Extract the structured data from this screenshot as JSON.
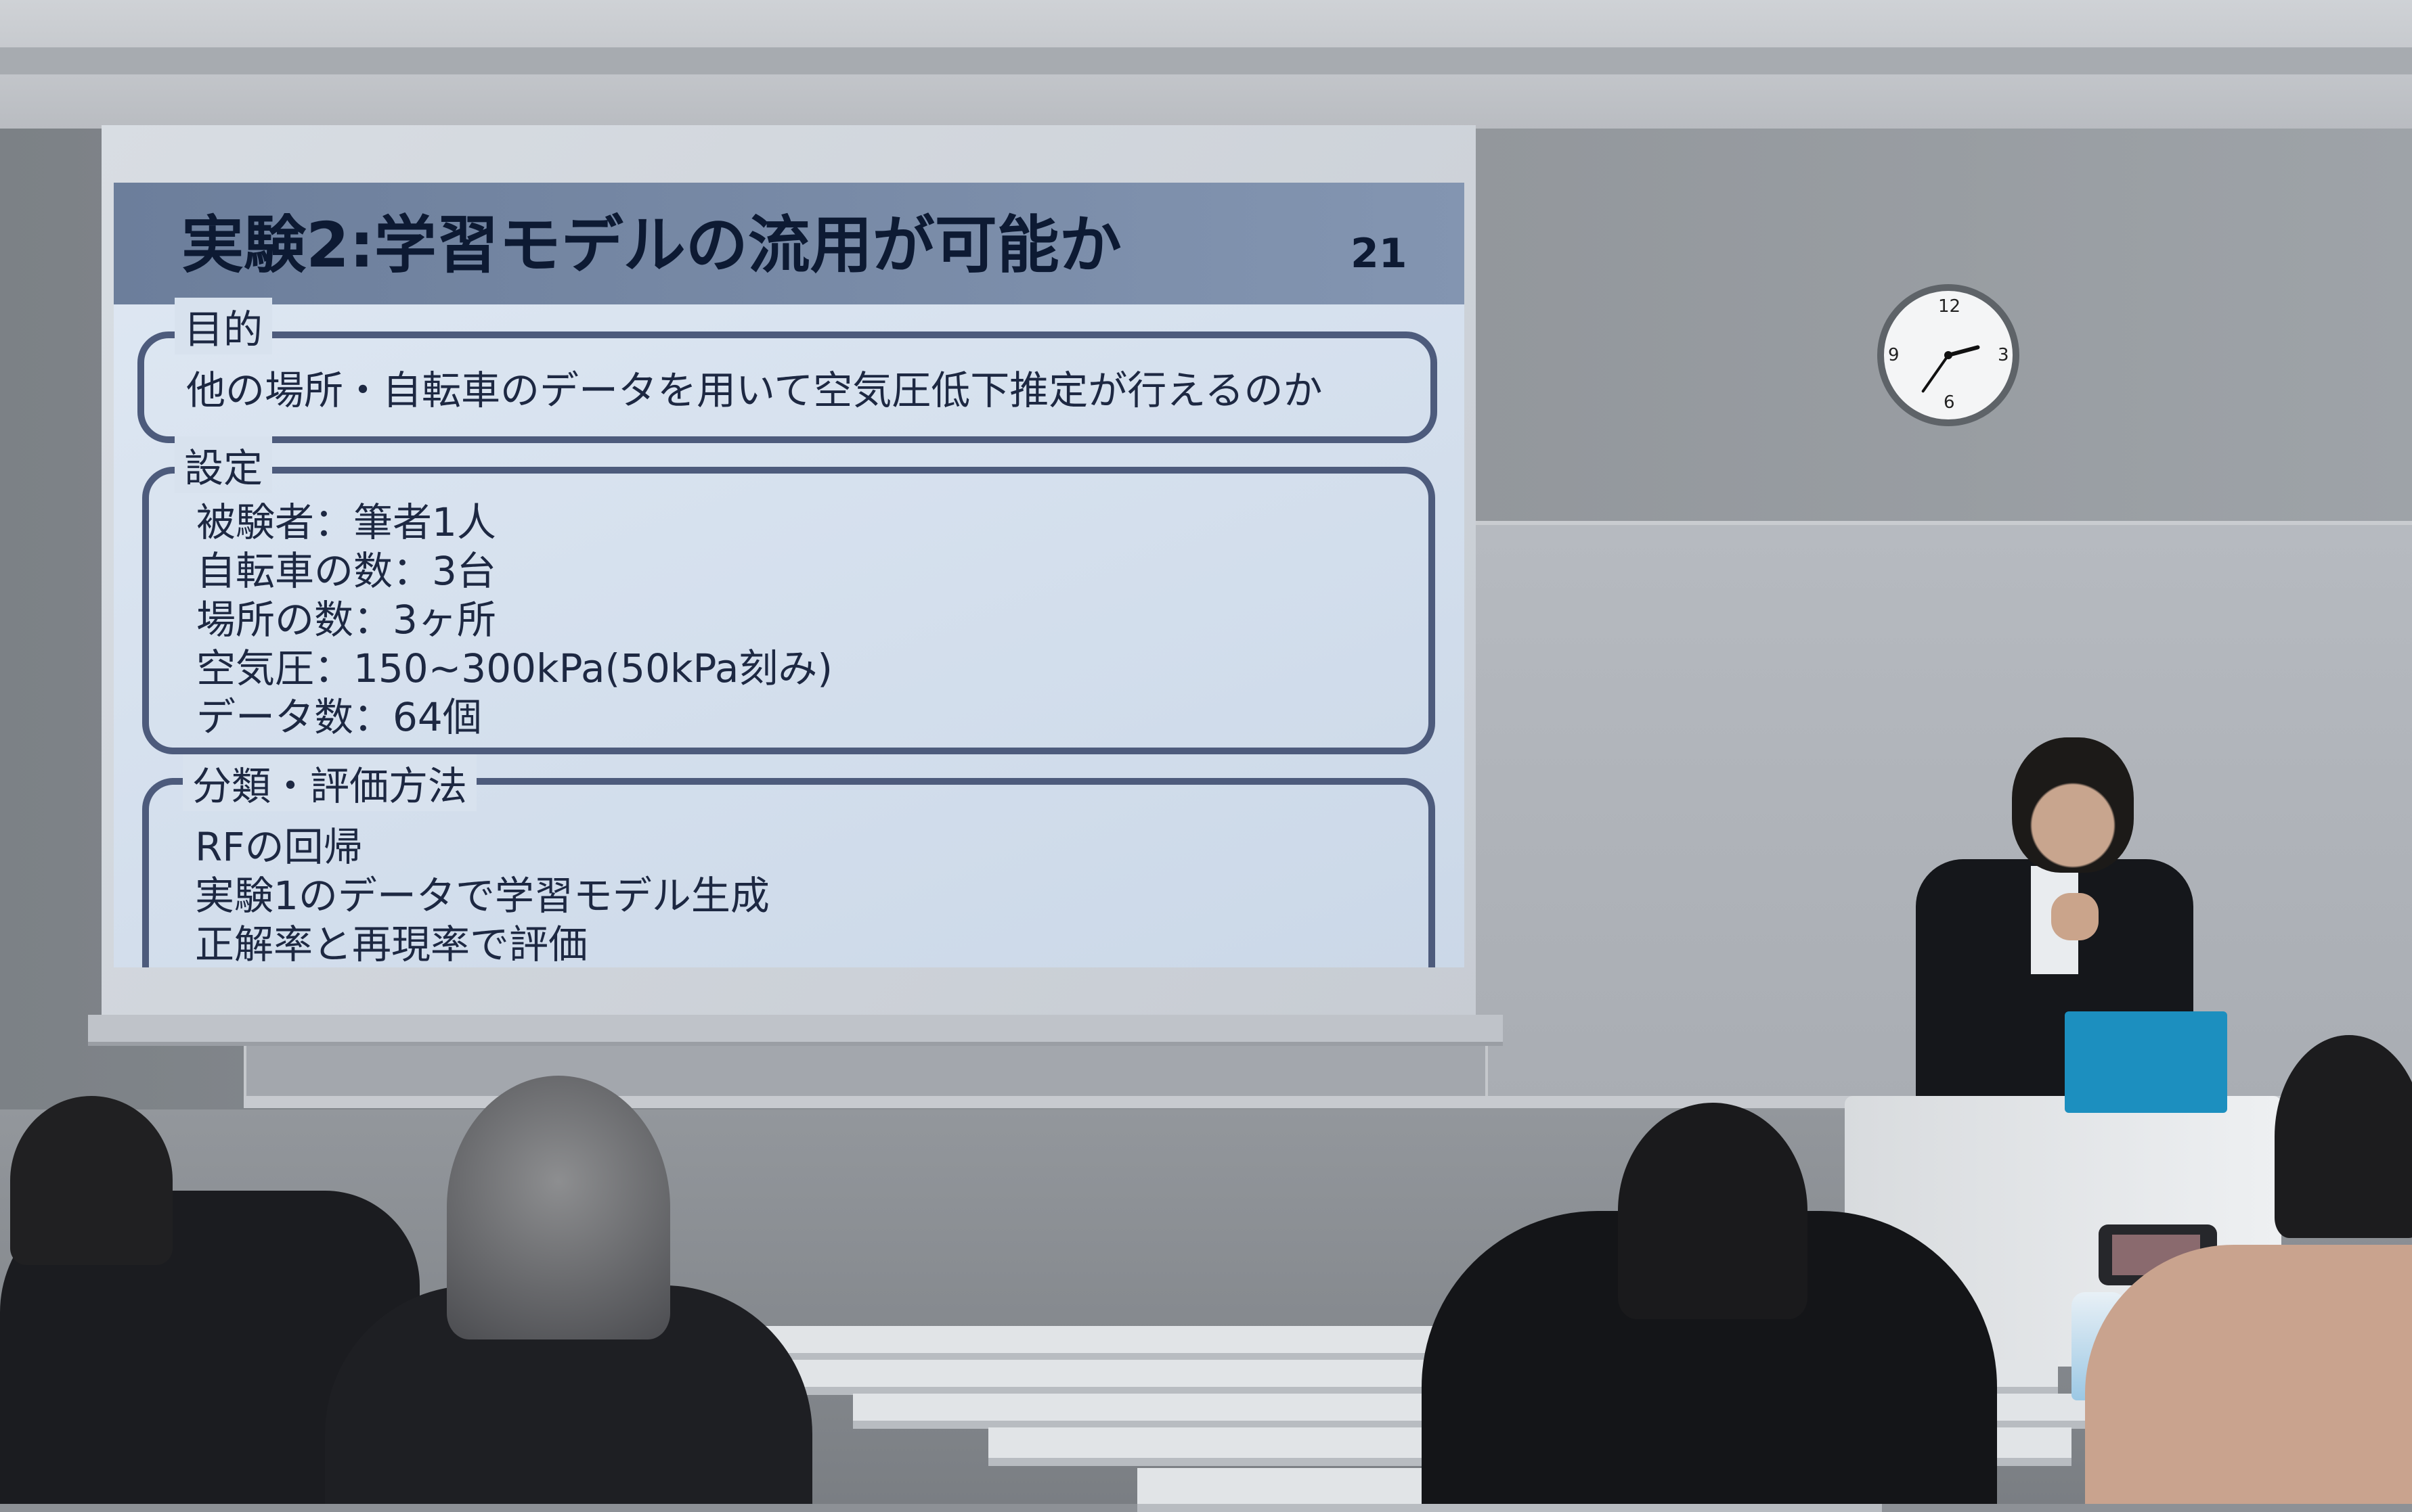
{
  "slide": {
    "title": "実験2:学習モデルの流用が可能か",
    "number": "21",
    "sections": [
      {
        "heading": "目的",
        "lines": [
          "他の場所・自転車のデータを用いて空気圧低下推定が行えるのか"
        ]
      },
      {
        "heading": "設定",
        "lines": [
          "被験者：筆者1人",
          "自転車の数：3台",
          "場所の数：3ヶ所",
          "空気圧：150~300kPa(50kPa刻み)",
          "データ数：64個"
        ]
      },
      {
        "heading": "分類・評価方法",
        "lines": [
          "RFの回帰",
          "実験1のデータで学習モデル生成",
          "正解率と再現率で評価"
        ]
      }
    ],
    "colors": {
      "header": "#7789a6",
      "text": "#1d2842",
      "box_border": "#4d5b7c",
      "background": "#d8e2ee"
    }
  },
  "clock": {
    "numerals": [
      "12",
      "3",
      "6",
      "9"
    ],
    "icon": "wall-clock-icon"
  }
}
